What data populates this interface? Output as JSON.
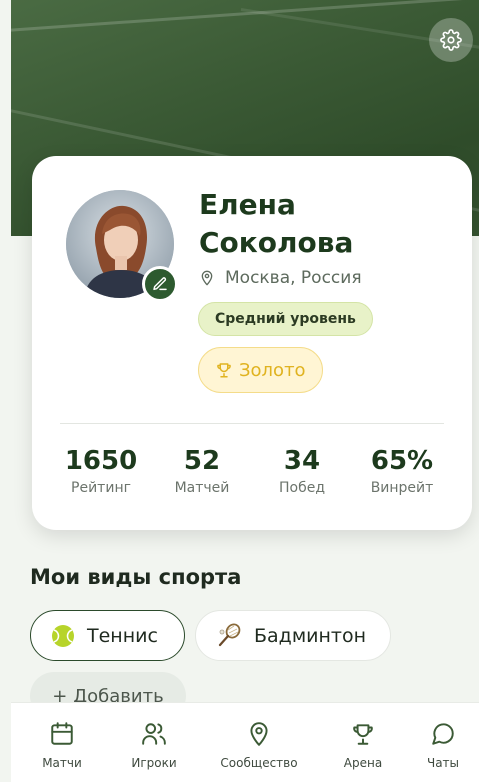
{
  "header": {
    "settings_icon": "gear-icon"
  },
  "profile": {
    "first_name": "Елена",
    "last_name": "Соколова",
    "location": "Москва, Россия",
    "level": "Средний уровень",
    "rank": "Золото"
  },
  "stats": [
    {
      "value": "1650",
      "label": "Рейтинг"
    },
    {
      "value": "52",
      "label": "Матчей"
    },
    {
      "value": "34",
      "label": "Побед"
    },
    {
      "value": "65%",
      "label": "Винрейт"
    }
  ],
  "sports": {
    "title": "Мои виды спорта",
    "items": [
      {
        "label": "Теннис",
        "icon": "tennis-ball-icon",
        "active": true
      },
      {
        "label": "Бадминтон",
        "icon": "badminton-racket-icon",
        "active": false
      }
    ],
    "add_label": "+ Добавить"
  },
  "nav": [
    {
      "label": "Матчи",
      "icon": "calendar-icon"
    },
    {
      "label": "Игроки",
      "icon": "users-icon"
    },
    {
      "label": "Сообщество",
      "icon": "map-pin-icon"
    },
    {
      "label": "Арена",
      "icon": "trophy-icon"
    },
    {
      "label": "Чаты",
      "icon": "chat-icon"
    }
  ],
  "colors": {
    "primary_green": "#2d5a2f",
    "gold": "#e0b320",
    "level_bg": "#e8f2c8"
  }
}
